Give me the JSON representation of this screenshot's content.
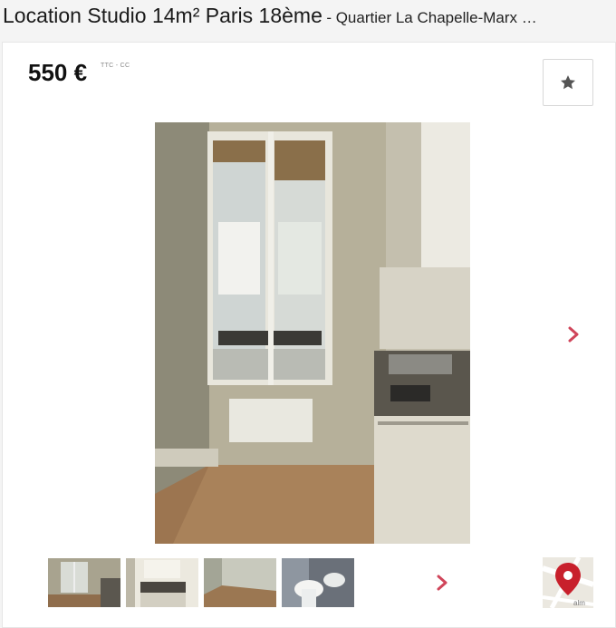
{
  "listing": {
    "title": "Location Studio 14m² Paris 18ème",
    "subtitle": "- Quartier La Chapelle-Marx …",
    "price": "550 €",
    "price_note": "TTC - CC"
  },
  "icons": {
    "favorite": "star-icon",
    "next": "chevron-right-icon",
    "map": "map-pin-icon"
  },
  "colors": {
    "accent": "#d0455a",
    "pin": "#c8202c",
    "star": "#555555"
  },
  "map": {
    "street_fragment": "alm"
  },
  "gallery": {
    "thumb_count": 4
  }
}
